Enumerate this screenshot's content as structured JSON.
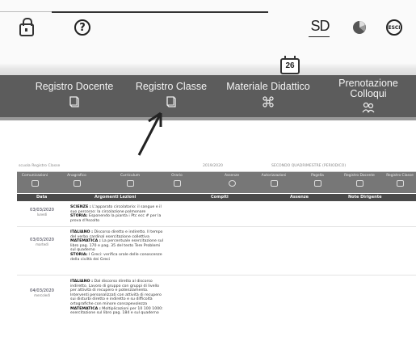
{
  "top_toolbar": {
    "icons": {
      "lock": "lock-icon",
      "help": "question-icon",
      "help_glyph": "?",
      "sd_logo": "S",
      "sd_logo_d": "D",
      "pie": "pie-chart-icon",
      "exit": "ESCI"
    },
    "calendar_day": "26",
    "nav_items": [
      {
        "label": "Registro Docente",
        "icon": "book-icon"
      },
      {
        "label": "Registro Classe",
        "icon": "book-icon"
      },
      {
        "label": "Materiale Didattico",
        "icon": "molecule-icon"
      },
      {
        "label_line1": "Prenotazione",
        "label_line2": "Colloqui",
        "icon": "people-icon"
      }
    ],
    "colors": {
      "nav_bg": "#5c5c5c",
      "nav_text": "#f4f4f4"
    }
  },
  "register": {
    "breadcrumb": "scuola Registro Classe",
    "year": "2019/2020",
    "class_info": "SECONDO QUADRIMESTRE (PERIODICO)",
    "nav_items": [
      "Comunicazioni",
      "Anagrafico",
      "Curriculum",
      "Orario",
      "Assenze",
      "Autorizzazioni",
      "Pagella",
      "Registro Docente",
      "Registro Classe"
    ],
    "columns": [
      "Data",
      "Argomenti Lezioni",
      "Compiti",
      "Assenze",
      "Note Dirigente"
    ],
    "rows": [
      {
        "date": "03/03/2020",
        "day": "lunedì",
        "lessons": [
          {
            "subject": "SCIENZE :",
            "text": "L'apparato circolatorio: il sangue e il suo percorso: la circolazione polmonare"
          },
          {
            "subject": "STORIA:",
            "text": "Esponendo la pianta i Ptc ecc # per la prova d'Ascolto"
          }
        ]
      },
      {
        "date": "03/03/2020",
        "day": "martedì",
        "lessons": [
          {
            "subject": "ITALIANO :",
            "text": "Discorso diretto e indiretto. Il tempo del verbo cardinal esercitazione collettiva"
          },
          {
            "subject": "MATEMATICA :",
            "text": "La percentuale esercitazione sul libro pag. 170 e pag. 35 del testo Tere Problemi sul quaderno"
          },
          {
            "subject": "STORIA:",
            "text": "I Greci: verifica orale delle conoscenze della civiltà dei Greci"
          }
        ]
      },
      {
        "date": "04/03/2020",
        "day": "mercoledì",
        "lessons": [
          {
            "subject": "ITALIANO :",
            "text": "Dal discorso diretto al discorso indiretto. Lavoro di gruppo con gruppi di livello per attività di recupero e potenziamento. Interventi personalizzati con attività di recupero sui disturbi diretto e indiretto e su difficoltà ortografiche con minore consapevolezza"
          },
          {
            "subject": "MATEMATICA :",
            "text": "Moltiplicazioni per 10 100 1000: esercitazione sul libro pag. 184 e sul quaderno"
          }
        ]
      }
    ]
  }
}
